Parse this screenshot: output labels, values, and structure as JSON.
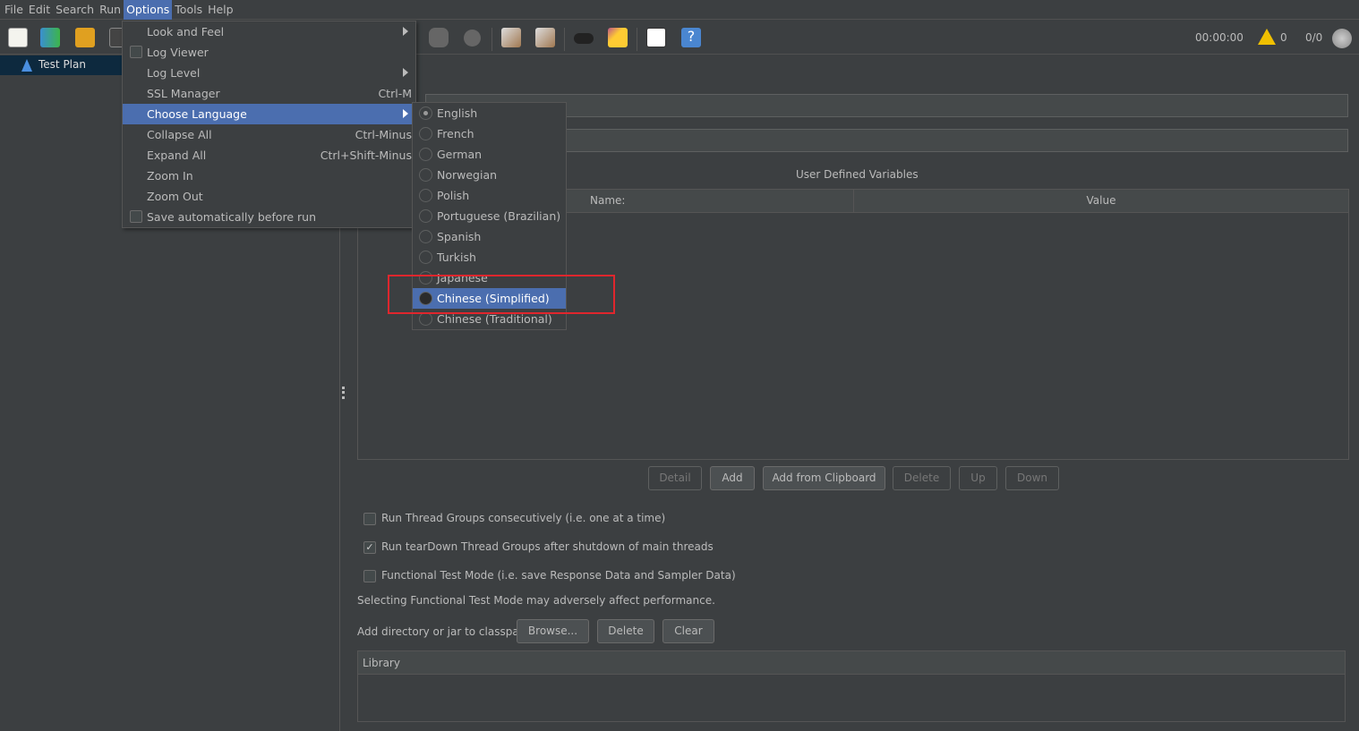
{
  "menubar": [
    {
      "label": "File"
    },
    {
      "label": "Edit"
    },
    {
      "label": "Search"
    },
    {
      "label": "Run"
    },
    {
      "label": "Options",
      "active": true
    },
    {
      "label": "Tools"
    },
    {
      "label": "Help"
    }
  ],
  "toolbar": {
    "elapsed": "00:00:00",
    "warnings": "0",
    "threads": "0/0",
    "icons": [
      "new-icon",
      "templates-icon",
      "open-icon",
      "save-icon",
      "stop-icon",
      "shutdown-icon",
      "clear-icon",
      "clear-all-icon",
      "search-icon",
      "reset-search-icon",
      "function-helper-icon",
      "help-icon",
      "warning-icon",
      "remote-icon"
    ]
  },
  "tree": {
    "items": [
      {
        "label": "Test Plan"
      }
    ]
  },
  "options_menu": {
    "items": [
      {
        "label": "Look and Feel",
        "submenu": true
      },
      {
        "label": "Log Viewer",
        "checkbox": true
      },
      {
        "label": "Log Level",
        "submenu": true
      },
      {
        "label": "SSL Manager",
        "shortcut": "Ctrl-M"
      },
      {
        "label": "Choose Language",
        "submenu": true,
        "selected": true
      },
      {
        "label": "Collapse All",
        "shortcut": "Ctrl-Minus"
      },
      {
        "label": "Expand All",
        "shortcut": "Ctrl+Shift-Minus"
      },
      {
        "label": "Zoom In"
      },
      {
        "label": "Zoom Out"
      },
      {
        "label": "Save automatically before run",
        "checkbox": true
      }
    ]
  },
  "language_menu": {
    "items": [
      {
        "label": "English",
        "checked": true
      },
      {
        "label": "French"
      },
      {
        "label": "German"
      },
      {
        "label": "Norwegian"
      },
      {
        "label": "Polish"
      },
      {
        "label": "Portuguese (Brazilian)"
      },
      {
        "label": "Spanish"
      },
      {
        "label": "Turkish"
      },
      {
        "label": "Japanese"
      },
      {
        "label": "Chinese (Simplified)",
        "selected": true
      },
      {
        "label": "Chinese (Traditional)"
      }
    ],
    "highlight_color": "#e0262d"
  },
  "main": {
    "udv_title": "User Defined Variables",
    "columns": [
      "Name:",
      "Value"
    ],
    "buttons": {
      "detail": "Detail",
      "add": "Add",
      "add_clipboard": "Add from Clipboard",
      "delete": "Delete",
      "up": "Up",
      "down": "Down"
    },
    "options": [
      {
        "label": "Run Thread Groups consecutively (i.e. one at a time)",
        "checked": false
      },
      {
        "label": "Run tearDown Thread Groups after shutdown of main threads",
        "checked": true
      },
      {
        "label": "Functional Test Mode (i.e. save Response Data and Sampler Data)",
        "checked": false
      }
    ],
    "functional_note": "Selecting Functional Test Mode may adversely affect performance.",
    "classpath_label": "Add directory or jar to classpath",
    "classpath_buttons": {
      "browse": "Browse...",
      "delete": "Delete",
      "clear": "Clear"
    },
    "library_header": "Library"
  },
  "colors": {
    "accent": "#4b6eaf",
    "background": "#3c3f41"
  }
}
